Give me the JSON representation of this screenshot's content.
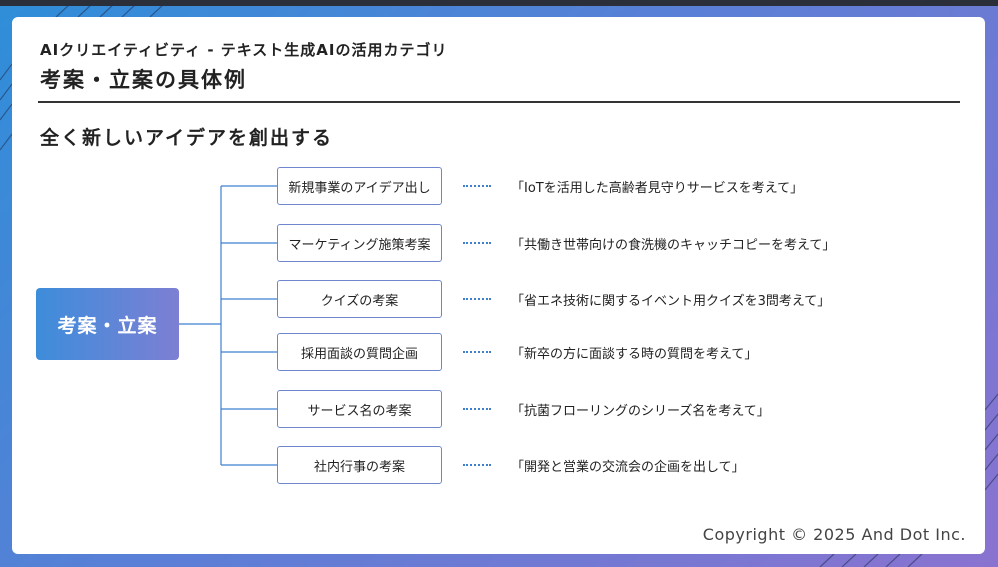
{
  "header": {
    "subtitle": "AIクリエイティビティ - テキスト生成AIの活用カテゴリ",
    "title": "考案・立案の具体例"
  },
  "section_title": "全く新しいアイデアを創出する",
  "root_label": "考案・立案",
  "items": [
    {
      "category": "新規事業のアイデア出し",
      "example": "「IoTを活用した高齢者見守りサービスを考えて」"
    },
    {
      "category": "マーケティング施策考案",
      "example": "「共働き世帯向けの食洗機のキャッチコピーを考えて」"
    },
    {
      "category": "クイズの考案",
      "example": "「省エネ技術に関するイベント用クイズを3問考えて」"
    },
    {
      "category": "採用面談の質問企画",
      "example": "「新卒の方に面談する時の質問を考えて」"
    },
    {
      "category": "サービス名の考案",
      "example": "「抗菌フローリングのシリーズ名を考えて」"
    },
    {
      "category": "社内行事の考案",
      "example": "「開発と営業の交流会の企画を出して」"
    }
  ],
  "footer": {
    "copyright": "Copyright © 2025 And Dot Inc."
  },
  "colors": {
    "accent_blue": "#2f8ed8",
    "accent_purple": "#8a73d0",
    "connector": "#3f7fd0",
    "box_border": "#6f86cf"
  }
}
